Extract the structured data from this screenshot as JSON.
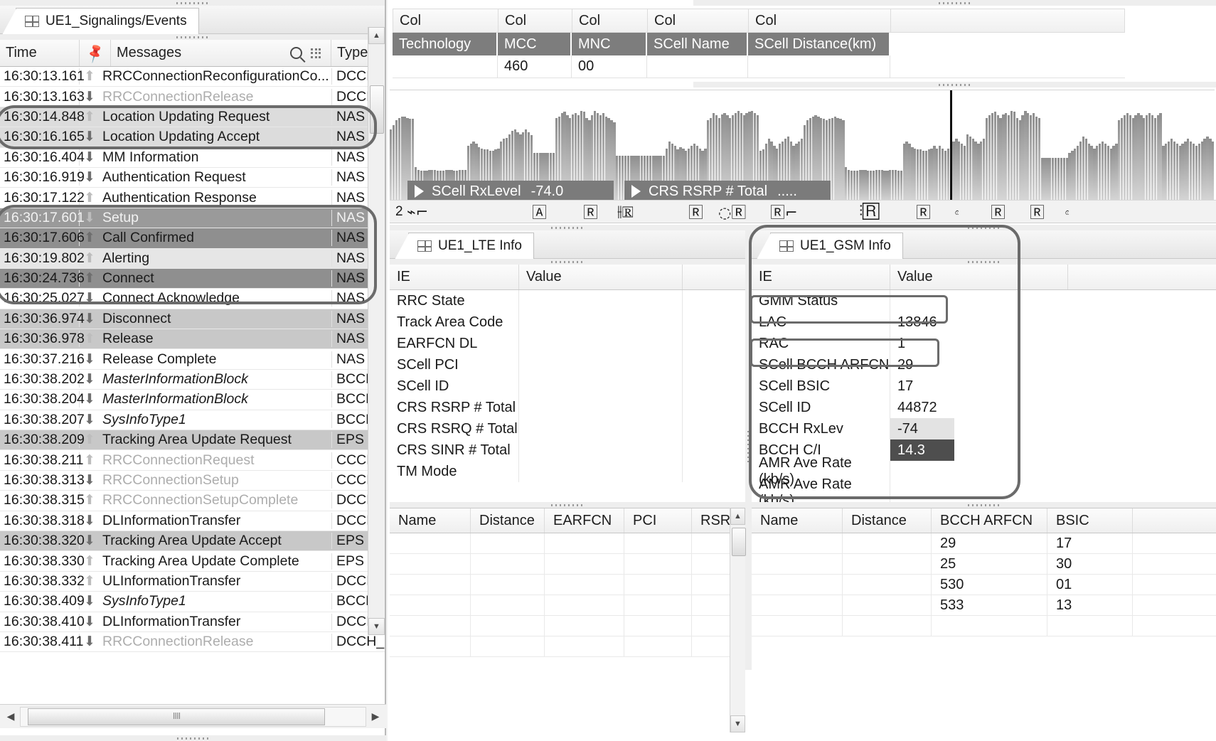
{
  "signalling_panel": {
    "tab_label": "UE1_Signalings/Events",
    "tab_icon": "grid-icon",
    "columns": {
      "time": "Time",
      "pin_icon": "pin-icon",
      "messages": "Messages",
      "search_icon": "search-icon",
      "grid_icon": "grid-menu-icon",
      "type": "Type"
    },
    "rows": [
      {
        "time": "16:30:13.161",
        "dir": "up",
        "msg": "RRCConnectionReconfigurationCo...",
        "type": "DCCH_",
        "style": "normal",
        "arrow": "light",
        "italic": false
      },
      {
        "time": "16:30:13.163",
        "dir": "down",
        "msg": "RRCConnectionRelease",
        "type": "DCCH_",
        "style": "dim",
        "arrow": "dark",
        "italic": false
      },
      {
        "time": "16:30:14.848",
        "dir": "up",
        "msg": "Location Updating Request",
        "type": "NAS MM",
        "style": "hl-light",
        "arrow": "light",
        "italic": false
      },
      {
        "time": "16:30:16.165",
        "dir": "down",
        "msg": "Location Updating Accept",
        "type": "NAS MM",
        "style": "hl-light",
        "arrow": "dark",
        "italic": false
      },
      {
        "time": "16:30:16.404",
        "dir": "down",
        "msg": "MM Information",
        "type": "NAS MM",
        "style": "normal",
        "arrow": "dark",
        "italic": false
      },
      {
        "time": "16:30:16.919",
        "dir": "down",
        "msg": "Authentication Request",
        "type": "NAS MM",
        "style": "normal",
        "arrow": "dark",
        "italic": false
      },
      {
        "time": "16:30:17.122",
        "dir": "up",
        "msg": "Authentication Response",
        "type": "NAS MM",
        "style": "normal",
        "arrow": "light",
        "italic": false
      },
      {
        "time": "16:30:17.601",
        "dir": "down",
        "msg": "Setup",
        "type": "NAS CC",
        "style": "hl-darker",
        "arrow": "light",
        "italic": false
      },
      {
        "time": "16:30:17.606",
        "dir": "up",
        "msg": "Call Confirmed",
        "type": "NAS CC",
        "style": "hl-dark",
        "arrow": "dark",
        "italic": false
      },
      {
        "time": "16:30:19.802",
        "dir": "up",
        "msg": "Alerting",
        "type": "NAS CC",
        "style": "hl-pale",
        "arrow": "light",
        "italic": false
      },
      {
        "time": "16:30:24.736",
        "dir": "up",
        "msg": "Connect",
        "type": "NAS CC",
        "style": "hl-dark",
        "arrow": "dark",
        "italic": false
      },
      {
        "time": "16:30:25.027",
        "dir": "down",
        "msg": "Connect Acknowledge",
        "type": "NAS CC",
        "style": "normal",
        "arrow": "dark",
        "italic": false
      },
      {
        "time": "16:30:36.974",
        "dir": "down",
        "msg": "Disconnect",
        "type": "NAS CC",
        "style": "hl-mid",
        "arrow": "dark",
        "italic": false
      },
      {
        "time": "16:30:36.978",
        "dir": "up",
        "msg": "Release",
        "type": "NAS CC",
        "style": "hl-mid",
        "arrow": "light",
        "italic": false
      },
      {
        "time": "16:30:37.216",
        "dir": "down",
        "msg": "Release Complete",
        "type": "NAS CC",
        "style": "normal",
        "arrow": "dark",
        "italic": false
      },
      {
        "time": "16:30:38.202",
        "dir": "down",
        "msg": "MasterInformationBlock",
        "type": "BCCH_",
        "style": "normal",
        "arrow": "dark",
        "italic": true
      },
      {
        "time": "16:30:38.204",
        "dir": "down",
        "msg": "MasterInformationBlock",
        "type": "BCCH_",
        "style": "normal",
        "arrow": "dark",
        "italic": true
      },
      {
        "time": "16:30:38.207",
        "dir": "down",
        "msg": "SysInfoType1",
        "type": "BCCH_",
        "style": "normal",
        "arrow": "dark",
        "italic": true
      },
      {
        "time": "16:30:38.209",
        "dir": "up",
        "msg": "Tracking Area Update Request",
        "type": "EPS MM",
        "style": "hl-mid",
        "arrow": "light",
        "italic": false
      },
      {
        "time": "16:30:38.211",
        "dir": "up",
        "msg": "RRCConnectionRequest",
        "type": "CCCH_",
        "style": "dim",
        "arrow": "light",
        "italic": false
      },
      {
        "time": "16:30:38.313",
        "dir": "down",
        "msg": "RRCConnectionSetup",
        "type": "CCCH_",
        "style": "dim",
        "arrow": "dark",
        "italic": false
      },
      {
        "time": "16:30:38.315",
        "dir": "up",
        "msg": "RRCConnectionSetupComplete",
        "type": "DCCH_",
        "style": "dim",
        "arrow": "light",
        "italic": false
      },
      {
        "time": "16:30:38.318",
        "dir": "down",
        "msg": "DLInformationTransfer",
        "type": "DCCH_",
        "style": "normal",
        "arrow": "dark",
        "italic": false
      },
      {
        "time": "16:30:38.320",
        "dir": "down",
        "msg": "Tracking Area Update Accept",
        "type": "EPS MM",
        "style": "hl-mid",
        "arrow": "dark",
        "italic": false
      },
      {
        "time": "16:30:38.330",
        "dir": "up",
        "msg": "Tracking Area Update Complete",
        "type": "EPS MM",
        "style": "normal",
        "arrow": "light",
        "italic": false
      },
      {
        "time": "16:30:38.332",
        "dir": "up",
        "msg": "ULInformationTransfer",
        "type": "DCCH_",
        "style": "normal",
        "arrow": "light",
        "italic": false
      },
      {
        "time": "16:30:38.409",
        "dir": "down",
        "msg": "SysInfoType1",
        "type": "BCCH_",
        "style": "normal",
        "arrow": "dark",
        "italic": true
      },
      {
        "time": "16:30:38.410",
        "dir": "down",
        "msg": "DLInformationTransfer",
        "type": "DCCH_",
        "style": "normal",
        "arrow": "dark",
        "italic": false
      },
      {
        "time": "16:30:38.411",
        "dir": "down",
        "msg": "RRCConnectionRelease",
        "type": "DCCH_",
        "style": "dim",
        "arrow": "dark",
        "italic": false
      }
    ],
    "hscroll": {
      "left_arrow": "◀",
      "right_arrow": "▶",
      "thumb_grip": "IIII"
    }
  },
  "col_table": {
    "header_labels": [
      "Col",
      "Col",
      "Col",
      "Col",
      "Col",
      ""
    ],
    "field_names": [
      "Technology",
      "MCC",
      "MNC",
      "SCell Name",
      "SCell Distance(km)"
    ],
    "values": [
      "",
      "460",
      "00",
      "",
      ""
    ]
  },
  "chart_data": {
    "type": "bar",
    "title": "",
    "xlabel": "",
    "ylabel": "",
    "legend_position": "bottom-left",
    "legend": [
      {
        "name": "SCell RxLevel",
        "value": "-74.0"
      },
      {
        "name": "CRS RSRP # Total",
        "value": "....."
      }
    ],
    "cursor_x_index": 203,
    "ylim": [
      0,
      100
    ],
    "values": [
      62,
      66,
      70,
      72,
      73,
      73,
      72,
      71,
      71,
      30,
      28,
      27,
      27,
      27,
      28,
      28,
      28,
      27,
      27,
      27,
      28,
      28,
      28,
      27,
      27,
      28,
      28,
      28,
      48,
      50,
      52,
      50,
      47,
      46,
      45,
      45,
      44,
      44,
      45,
      46,
      52,
      54,
      55,
      58,
      61,
      62,
      60,
      58,
      60,
      62,
      60,
      57,
      42,
      42,
      42,
      42,
      42,
      42,
      42,
      42,
      72,
      73,
      76,
      77,
      74,
      72,
      75,
      76,
      74,
      78,
      77,
      72,
      70,
      74,
      78,
      76,
      74,
      76,
      73,
      72,
      70,
      68,
      40,
      40,
      40,
      40,
      40,
      40,
      40,
      40,
      40,
      40,
      40,
      40,
      40,
      40,
      40,
      40,
      40,
      40,
      46,
      52,
      50,
      48,
      45,
      47,
      46,
      44,
      46,
      48,
      50,
      48,
      46,
      44,
      46,
      70,
      72,
      76,
      74,
      72,
      75,
      76,
      74,
      72,
      74,
      76,
      78,
      76,
      74,
      76,
      77,
      78,
      76,
      74,
      44,
      45,
      50,
      54,
      52,
      48,
      46,
      50,
      52,
      54,
      56,
      52,
      48,
      50,
      52,
      54,
      66,
      70,
      72,
      73,
      74,
      73,
      72,
      71,
      70,
      71,
      72,
      73,
      72,
      71,
      70,
      30,
      28,
      27,
      27,
      27,
      28,
      28,
      28,
      27,
      27,
      27,
      28,
      28,
      28,
      27,
      27,
      28,
      28,
      28,
      27,
      27,
      50,
      52,
      50,
      47,
      46,
      45,
      45,
      44,
      44,
      45,
      46,
      48,
      46,
      48,
      46,
      44,
      46,
      50,
      52,
      54,
      52,
      50,
      48,
      58,
      56,
      54,
      52,
      50,
      52,
      54,
      72,
      74,
      76,
      77,
      74,
      72,
      75,
      76,
      74,
      78,
      77,
      72,
      70,
      74,
      78,
      76,
      74,
      76,
      73,
      72,
      38,
      38,
      38,
      38,
      38,
      38,
      38,
      38,
      38,
      38,
      42,
      44,
      46,
      48,
      52,
      56,
      54,
      50,
      48,
      46,
      48,
      50,
      52,
      50,
      48,
      46,
      48,
      50,
      70,
      72,
      74,
      76,
      74,
      72,
      74,
      76,
      74,
      72,
      74,
      76,
      74,
      72,
      74,
      76,
      48,
      50,
      52,
      54,
      52,
      50,
      48,
      50,
      52,
      54,
      52,
      50,
      48,
      50,
      52,
      54,
      56,
      54,
      52
    ]
  },
  "icon_strip": {
    "leading_number": "2",
    "icons": [
      "curve-pan-icon",
      "text-marker-icon",
      "ruler-icon",
      "ruler-double-icon",
      "ruler-icon",
      "ruler-pair-icon",
      "ruler-hook-icon",
      "ruler-cluster-icon",
      "ruler-icon",
      "loop-icon",
      "ruler-marked-icon",
      "ruler-icon",
      "ruler-edge-icon"
    ]
  },
  "lte_info": {
    "tab_label": "UE1_LTE Info",
    "tab_icon": "grid-icon",
    "headers": [
      "IE",
      "Value"
    ],
    "rows": [
      {
        "ie": "RRC State",
        "value": ""
      },
      {
        "ie": "Track Area Code",
        "value": ""
      },
      {
        "ie": "EARFCN DL",
        "value": ""
      },
      {
        "ie": "SCell PCI",
        "value": ""
      },
      {
        "ie": "SCell ID",
        "value": ""
      },
      {
        "ie": "CRS RSRP # Total",
        "value": ""
      },
      {
        "ie": "CRS RSRQ # Total",
        "value": ""
      },
      {
        "ie": "CRS SINR # Total",
        "value": ""
      },
      {
        "ie": "TM Mode",
        "value": ""
      }
    ]
  },
  "gsm_info": {
    "tab_label": "UE1_GSM Info",
    "tab_icon": "grid-icon",
    "headers": [
      "IE",
      "Value"
    ],
    "rows": [
      {
        "ie": "GMM Status",
        "value": "",
        "value_style": "plain"
      },
      {
        "ie": "LAC",
        "value": "13846",
        "value_style": "plain"
      },
      {
        "ie": "RAC",
        "value": "1",
        "value_style": "plain"
      },
      {
        "ie": "SCell BCCH ARFCN",
        "value": "29",
        "value_style": "plain"
      },
      {
        "ie": "SCell BSIC",
        "value": "17",
        "value_style": "plain"
      },
      {
        "ie": "SCell ID",
        "value": "44872",
        "value_style": "plain"
      },
      {
        "ie": "BCCH RxLev",
        "value": "-74",
        "value_style": "gray"
      },
      {
        "ie": "BCCH C/I",
        "value": "14.3",
        "value_style": "dark"
      },
      {
        "ie": "AMR Ave Rate (kb/s)",
        "value": "",
        "value_style": "plain"
      },
      {
        "ie": "AMR Ave Rate (kb/s)",
        "value": "",
        "value_style": "plain"
      }
    ]
  },
  "lte_neighbor_table": {
    "headers": [
      "Name",
      "Distance",
      "EARFCN",
      "PCI",
      "RSR"
    ],
    "rows": [
      {
        "name": "",
        "distance": "",
        "earfcn": "",
        "pci": "",
        "rsr": ""
      },
      {
        "name": "",
        "distance": "",
        "earfcn": "",
        "pci": "",
        "rsr": ""
      },
      {
        "name": "",
        "distance": "",
        "earfcn": "",
        "pci": "",
        "rsr": ""
      },
      {
        "name": "",
        "distance": "",
        "earfcn": "",
        "pci": "",
        "rsr": ""
      },
      {
        "name": "",
        "distance": "",
        "earfcn": "",
        "pci": "",
        "rsr": ""
      },
      {
        "name": "",
        "distance": "",
        "earfcn": "",
        "pci": "",
        "rsr": ""
      }
    ]
  },
  "gsm_neighbor_table": {
    "headers": [
      "Name",
      "Distance",
      "BCCH ARFCN",
      "BSIC"
    ],
    "rows": [
      {
        "name": "",
        "distance": "",
        "arfcn": "29",
        "bsic": "17"
      },
      {
        "name": "",
        "distance": "",
        "arfcn": "25",
        "bsic": "30"
      },
      {
        "name": "",
        "distance": "",
        "arfcn": "530",
        "bsic": "01"
      },
      {
        "name": "",
        "distance": "",
        "arfcn": "533",
        "bsic": "13"
      },
      {
        "name": "",
        "distance": "",
        "arfcn": "",
        "bsic": ""
      }
    ]
  },
  "colors": {
    "header_fill": "#7d7d7d",
    "selection_dark": "#8f8f8f",
    "selection_light": "#dcdcdc",
    "value_dark": "#4e4e4e",
    "annotation": "#6b6b6b",
    "bar": "#8e8e8e"
  }
}
